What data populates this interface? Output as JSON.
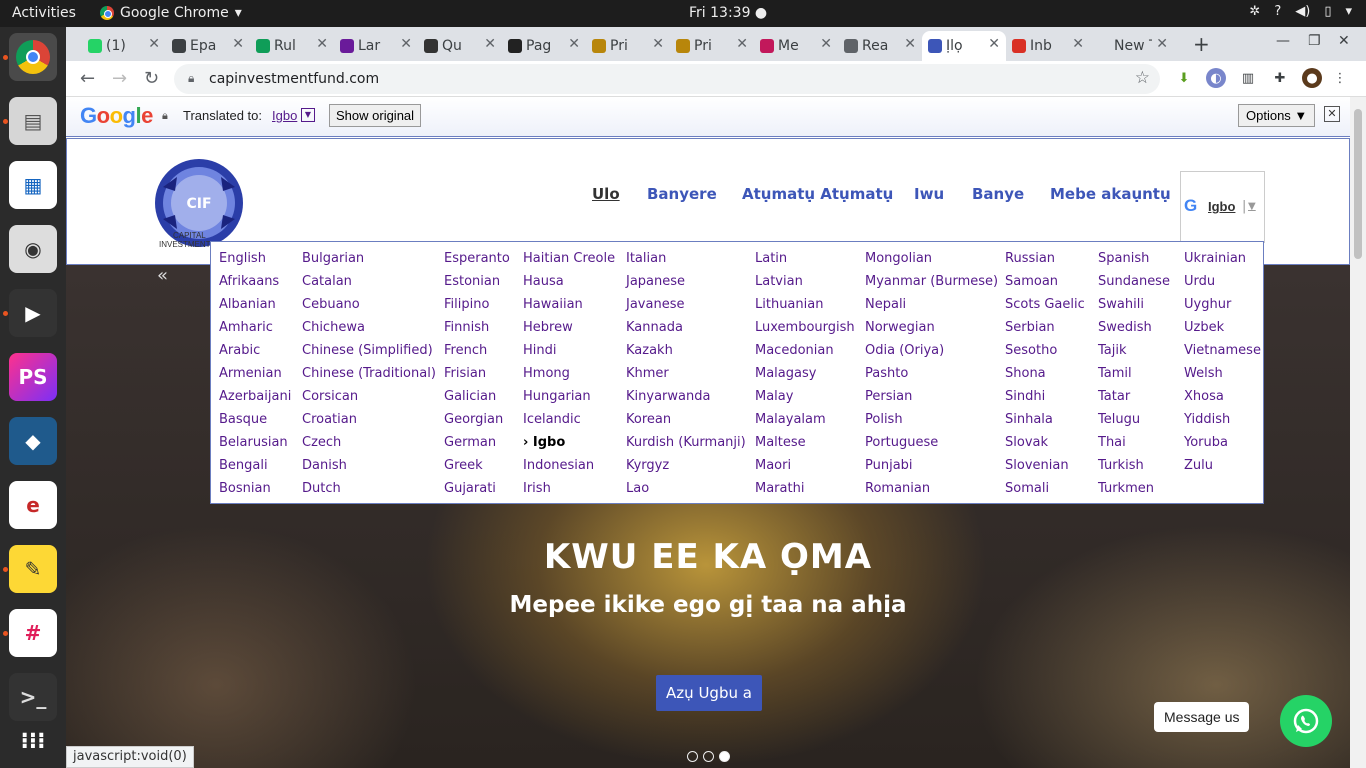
{
  "os": {
    "activities": "Activities",
    "app_name": "Google Chrome",
    "clock": "Fri 13:39 ●"
  },
  "tabs": [
    {
      "label": "(1)",
      "fav_color": "#25d366"
    },
    {
      "label": "Epa",
      "fav_color": "#3c4043"
    },
    {
      "label": "Rul",
      "fav_color": "#0f9d58"
    },
    {
      "label": "Lar",
      "fav_color": "#6a1b9a"
    },
    {
      "label": "Qu",
      "fav_color": "#333333"
    },
    {
      "label": "Pag",
      "fav_color": "#222222"
    },
    {
      "label": "Pri",
      "fav_color": "#b8860b"
    },
    {
      "label": "Pri",
      "fav_color": "#b8860b"
    },
    {
      "label": "Me",
      "fav_color": "#c2185b"
    },
    {
      "label": "Rea",
      "fav_color": "#5f6368"
    },
    {
      "label": "Ịlọ",
      "fav_color": "#3d56b8",
      "active": true
    },
    {
      "label": "Inb",
      "fav_color": "#d93025"
    },
    {
      "label": "New Ta",
      "fav_color": ""
    }
  ],
  "address": {
    "url": "capinvestmentfund.com"
  },
  "translate_bar": {
    "google": [
      "G",
      "o",
      "o",
      "g",
      "l",
      "e"
    ],
    "translated_to": "Translated to:",
    "language": "Igbo",
    "show_original": "Show original",
    "options": "Options ▼",
    "close": "✕"
  },
  "site": {
    "logo_initials": "CIF",
    "logo_text_1": "CAPITAL",
    "logo_text_2": "INVESTMENT",
    "nav": [
      "Ulo",
      "Banyere",
      "Atụmatụ Atụmatụ",
      "Iwu",
      "Banye",
      "Mebe akaụntụ"
    ],
    "lang_selector": "Igbo",
    "lang_selector_divider": "|",
    "lang_selector_arrow": "▼",
    "collapse": "«"
  },
  "hero": {
    "title": "KWU EE KA ỌMA",
    "subtitle": "Mepee ikike ego gị taa na ahịa",
    "button": "Azụ Ugbu a"
  },
  "language_menu": {
    "columns": [
      [
        "English",
        "Afrikaans",
        "Albanian",
        "Amharic",
        "Arabic",
        "Armenian",
        "Azerbaijani",
        "Basque",
        "Belarusian",
        "Bengali",
        "Bosnian"
      ],
      [
        "Bulgarian",
        "Catalan",
        "Cebuano",
        "Chichewa",
        "Chinese (Simplified)",
        "Chinese (Traditional)",
        "Corsican",
        "Croatian",
        "Czech",
        "Danish",
        "Dutch"
      ],
      [
        "Esperanto",
        "Estonian",
        "Filipino",
        "Finnish",
        "French",
        "Frisian",
        "Galician",
        "Georgian",
        "German",
        "Greek",
        "Gujarati"
      ],
      [
        "Haitian Creole",
        "Hausa",
        "Hawaiian",
        "Hebrew",
        "Hindi",
        "Hmong",
        "Hungarian",
        "Icelandic",
        "› Igbo",
        "Indonesian",
        "Irish"
      ],
      [
        "Italian",
        "Japanese",
        "Javanese",
        "Kannada",
        "Kazakh",
        "Khmer",
        "Kinyarwanda",
        "Korean",
        "Kurdish (Kurmanji)",
        "Kyrgyz",
        "Lao"
      ],
      [
        "Latin",
        "Latvian",
        "Lithuanian",
        "Luxembourgish",
        "Macedonian",
        "Malagasy",
        "Malay",
        "Malayalam",
        "Maltese",
        "Maori",
        "Marathi"
      ],
      [
        "Mongolian",
        "Myanmar (Burmese)",
        "Nepali",
        "Norwegian",
        "Odia (Oriya)",
        "Pashto",
        "Persian",
        "Polish",
        "Portuguese",
        "Punjabi",
        "Romanian"
      ],
      [
        "Russian",
        "Samoan",
        "Scots Gaelic",
        "Serbian",
        "Sesotho",
        "Shona",
        "Sindhi",
        "Sinhala",
        "Slovak",
        "Slovenian",
        "Somali"
      ],
      [
        "Spanish",
        "Sundanese",
        "Swahili",
        "Swedish",
        "Tajik",
        "Tamil",
        "Tatar",
        "Telugu",
        "Thai",
        "Turkish",
        "Turkmen"
      ],
      [
        "Ukrainian",
        "Urdu",
        "Uyghur",
        "Uzbek",
        "Vietnamese",
        "Welsh",
        "Xhosa",
        "Yiddish",
        "Yoruba",
        "Zulu"
      ]
    ],
    "selected": "› Igbo"
  },
  "widgets": {
    "message_us": "Message us",
    "status_url": "javascript:void(0)"
  },
  "colors": {
    "accent": "#3d56b8",
    "link": "#551a8b",
    "whatsapp": "#25d366"
  }
}
